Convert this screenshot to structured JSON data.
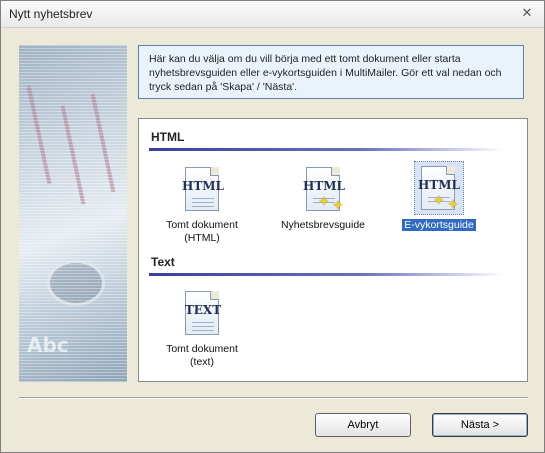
{
  "window": {
    "title": "Nytt nyhetsbrev"
  },
  "info_text": "Här kan du välja om du vill börja med ett tomt dokument eller starta nyhetsbrevsguiden eller e-vykortsguiden i MultiMailer. Gör ett val nedan och tryck sedan på 'Skapa' / 'Nästa'.",
  "sections": {
    "html": {
      "label": "HTML",
      "items": [
        {
          "icon_text": "HTML",
          "caption_line1": "Tomt dokument",
          "caption_line2": "(HTML)",
          "icon": "html-document-icon",
          "selected": false
        },
        {
          "icon_text": "HTML",
          "caption_line1": "Nyhetsbrevsguide",
          "caption_line2": "",
          "icon": "html-wizard-icon",
          "selected": false
        },
        {
          "icon_text": "HTML",
          "caption_line1": "E-vykortsguide",
          "caption_line2": "",
          "icon": "html-wizard-icon",
          "selected": true
        }
      ]
    },
    "text": {
      "label": "Text",
      "items": [
        {
          "icon_text": "TEXT",
          "caption_line1": "Tomt dokument",
          "caption_line2": "(text)",
          "icon": "text-document-icon",
          "selected": false
        }
      ]
    }
  },
  "buttons": {
    "cancel": "Avbryt",
    "next": "Nästa >"
  },
  "colors": {
    "selection": "#316ac5",
    "info_bg": "#eaf2fc",
    "section_line": "#3a3f9a"
  }
}
